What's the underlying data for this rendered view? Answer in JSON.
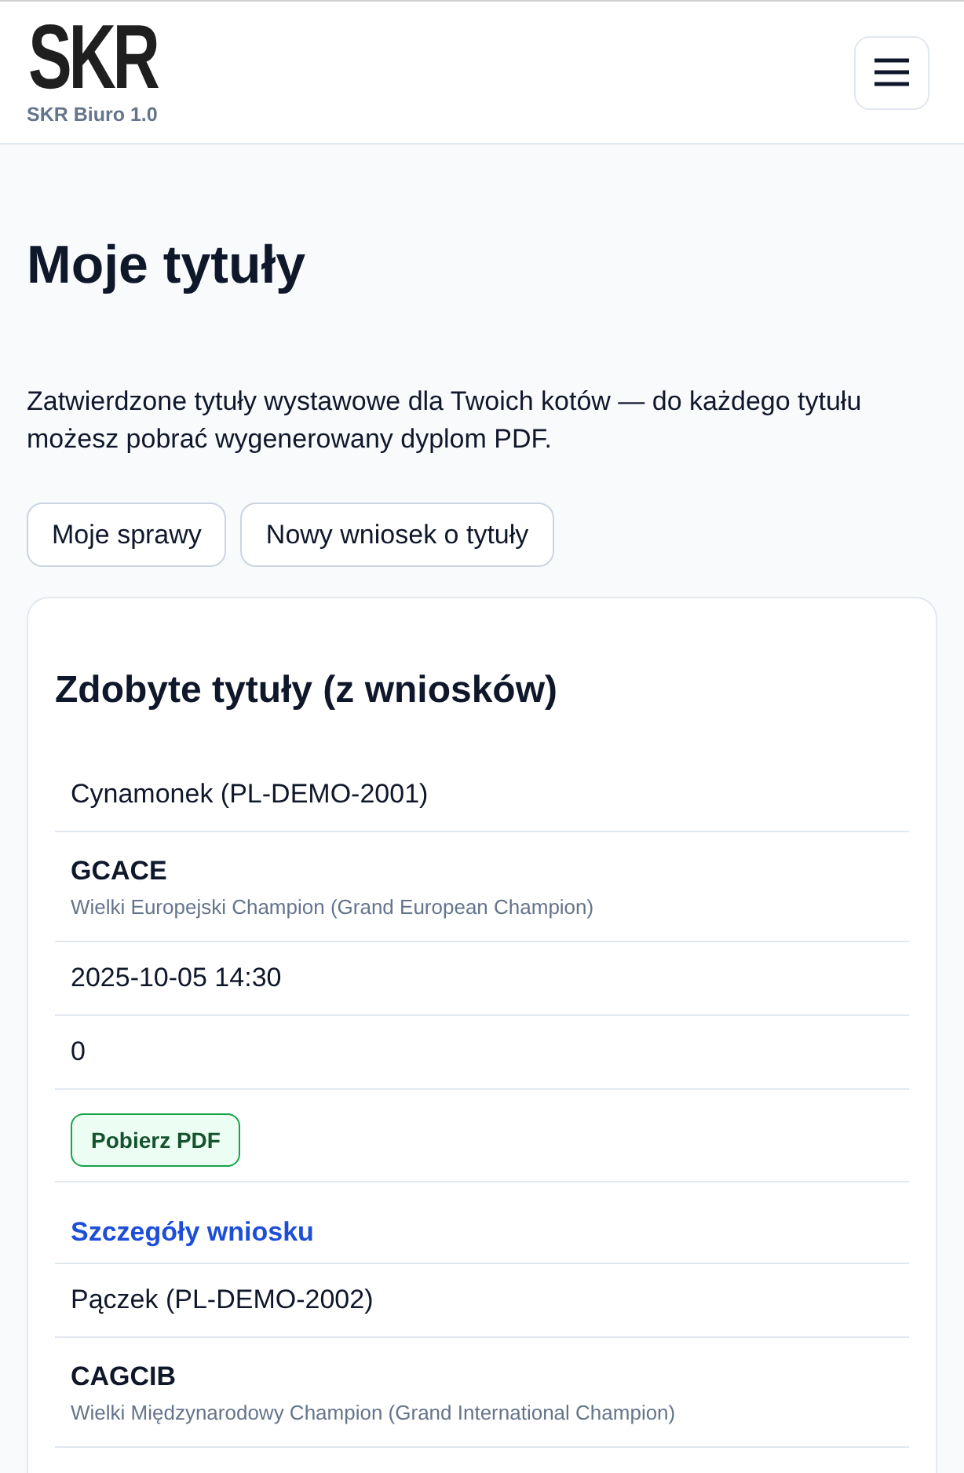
{
  "header": {
    "logo": "SKR",
    "subtitle": "SKR Biuro 1.0"
  },
  "page": {
    "title": "Moje tytuły",
    "intro": "Zatwierdzone tytuły wystawowe dla Twoich kotów — do każdego tytułu możesz pobrać wygenerowany dyplom PDF.",
    "buttons": [
      "Moje sprawy",
      "Nowy wniosek o tytuły"
    ]
  },
  "card": {
    "title": "Zdobyte tytuły (z wniosków)",
    "records": [
      {
        "cells": [
          {
            "kind": "cat",
            "text": "Cynamonek (PL-DEMO-2001)"
          },
          {
            "kind": "title",
            "code": "GCACE",
            "name": "Wielki Europejski Champion (Grand European Champion)"
          },
          {
            "kind": "date",
            "text": "2025-10-05 14:30"
          },
          {
            "kind": "count",
            "text": "0"
          },
          {
            "kind": "button",
            "label": "Pobierz PDF"
          },
          {
            "kind": "link",
            "label": "Szczegóły wniosku"
          }
        ]
      },
      {
        "cells": [
          {
            "kind": "cat",
            "text": "Pączek (PL-DEMO-2002)"
          },
          {
            "kind": "title",
            "code": "CAGCIB",
            "name": "Wielki Międzynarodowy Champion (Grand International Champion)"
          }
        ]
      }
    ]
  }
}
